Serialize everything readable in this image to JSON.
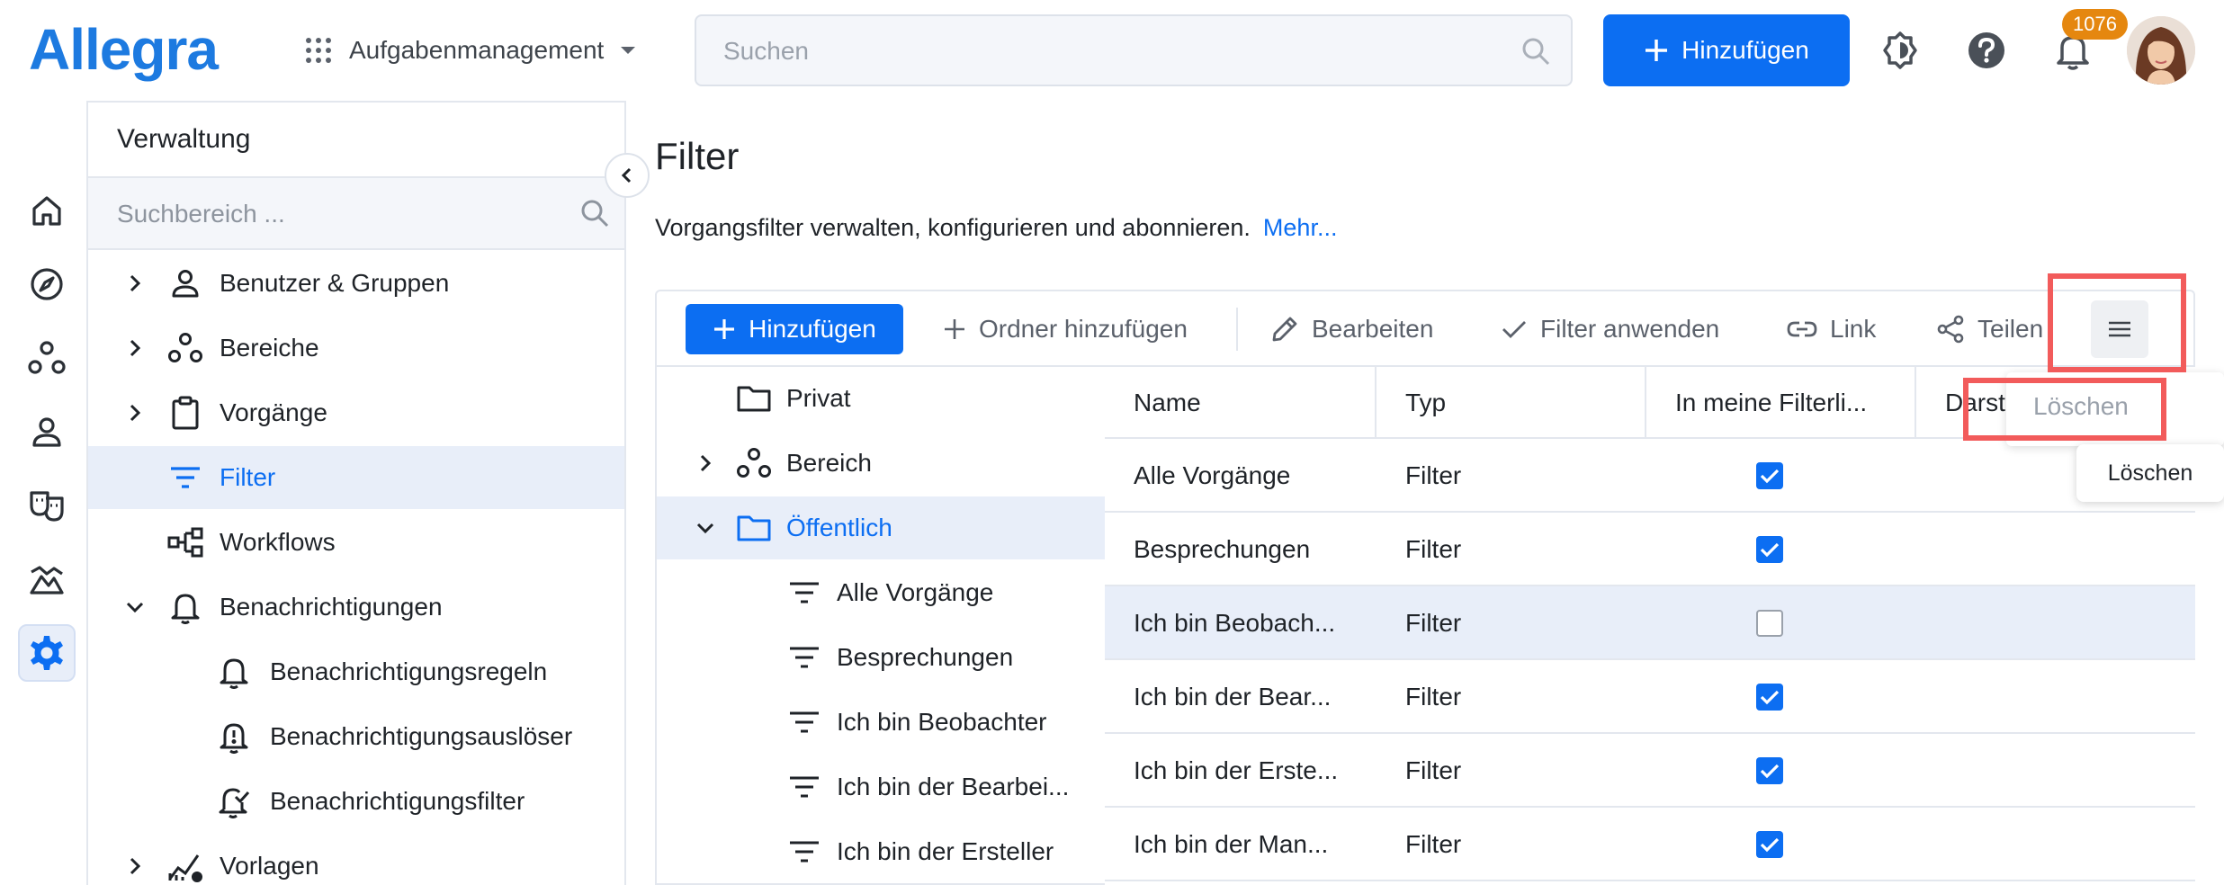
{
  "topbar": {
    "logo": "Allegra",
    "app_name": "Aufgabenmanagement",
    "search_placeholder": "Suchen",
    "add_button": "Hinzufügen",
    "notification_count": "1076"
  },
  "admin": {
    "title": "Verwaltung",
    "search_placeholder": "Suchbereich ...",
    "items": [
      {
        "label": "Benutzer & Gruppen",
        "icon": "user-icon"
      },
      {
        "label": "Bereiche",
        "icon": "areas-icon"
      },
      {
        "label": "Vorgänge",
        "icon": "clipboard-icon"
      },
      {
        "label": "Filter",
        "icon": "filter-icon"
      },
      {
        "label": "Workflows",
        "icon": "workflow-icon"
      },
      {
        "label": "Benachrichtigungen",
        "icon": "bell-icon"
      },
      {
        "label": "Benachrichtigungsregeln",
        "icon": "bell-icon"
      },
      {
        "label": "Benachrichtigungsauslöser",
        "icon": "bell-alert-icon"
      },
      {
        "label": "Benachrichtigungsfilter",
        "icon": "bell-check-icon"
      },
      {
        "label": "Vorlagen",
        "icon": "chart-icon"
      }
    ]
  },
  "main": {
    "title": "Filter",
    "description": "Vorgangsfilter verwalten, konfigurieren und abonnieren.",
    "more_link": "Mehr...",
    "toolbar": {
      "add": "Hinzufügen",
      "add_folder": "Ordner hinzufügen",
      "edit": "Bearbeiten",
      "apply": "Filter anwenden",
      "link": "Link",
      "share": "Teilen"
    },
    "tree": [
      {
        "label": "Privat"
      },
      {
        "label": "Bereich"
      },
      {
        "label": "Öffentlich"
      },
      {
        "label": "Alle Vorgänge"
      },
      {
        "label": "Besprechungen"
      },
      {
        "label": "Ich bin Beobachter"
      },
      {
        "label": "Ich bin der Bearbei..."
      },
      {
        "label": "Ich bin der Ersteller"
      }
    ],
    "columns": [
      "Name",
      "Typ",
      "In meine Filterli...",
      "Darst"
    ],
    "rows": [
      {
        "name": "Alle Vorgänge",
        "type": "Filter",
        "in_list": true
      },
      {
        "name": "Besprechungen",
        "type": "Filter",
        "in_list": true
      },
      {
        "name": "Ich bin Beobach...",
        "type": "Filter",
        "in_list": false
      },
      {
        "name": "Ich bin der Bear...",
        "type": "Filter",
        "in_list": true
      },
      {
        "name": "Ich bin der Erste...",
        "type": "Filter",
        "in_list": true
      },
      {
        "name": "Ich bin der Man...",
        "type": "Filter",
        "in_list": true
      }
    ],
    "menu": {
      "delete": "Löschen"
    },
    "tooltip": "Löschen"
  },
  "colors": {
    "accent": "#0c6ef2",
    "selected_bg": "#e8eef9",
    "highlight": "#f25b5b",
    "badge": "#e5870f"
  }
}
